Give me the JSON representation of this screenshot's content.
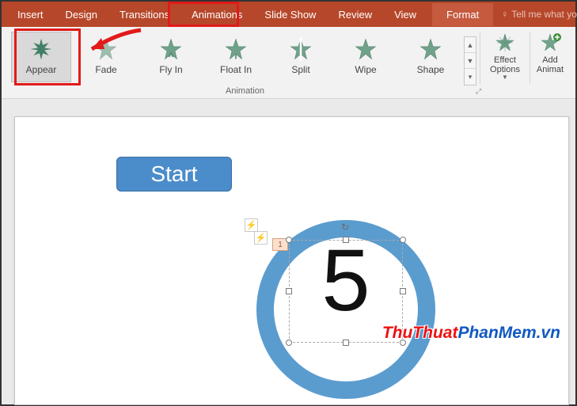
{
  "tabs": {
    "insert": "Insert",
    "design": "Design",
    "transitions": "Transitions",
    "animations": "Animations",
    "slideshow": "Slide Show",
    "review": "Review",
    "view": "View",
    "format": "Format",
    "tellme": "Tell me what you w"
  },
  "gallery": {
    "appear": "Appear",
    "fade": "Fade",
    "flyin": "Fly In",
    "floatin": "Float In",
    "split": "Split",
    "wipe": "Wipe",
    "shape": "Shape",
    "options": "Effect\nOptions",
    "add": "Add\nAnimat",
    "group_label": "Animation"
  },
  "slide": {
    "start": "Start",
    "number": "5",
    "tag": "1"
  },
  "watermark": {
    "red": "ThuThuat",
    "blue1": "PhanMem",
    "blue2": ".vn"
  }
}
